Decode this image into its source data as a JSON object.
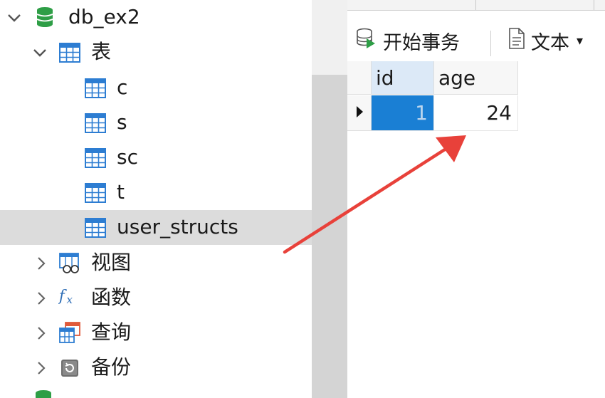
{
  "tree": {
    "database": {
      "label": "db_ex2"
    },
    "tables_group": {
      "label": "表"
    },
    "tables": [
      {
        "label": "c"
      },
      {
        "label": "s"
      },
      {
        "label": "sc"
      },
      {
        "label": "t"
      },
      {
        "label": "user_structs",
        "selected": true
      }
    ],
    "groups": [
      {
        "label": "视图",
        "icon": "view-icon"
      },
      {
        "label": "函数",
        "icon": "function-icon"
      },
      {
        "label": "查询",
        "icon": "query-icon"
      },
      {
        "label": "备份",
        "icon": "backup-icon"
      }
    ]
  },
  "toolbar": {
    "begin_transaction": "开始事务",
    "text": "文本"
  },
  "grid": {
    "columns": [
      "id",
      "age"
    ],
    "rows": [
      {
        "id": "1",
        "age": "24"
      }
    ]
  },
  "colors": {
    "accent": "#1a7fd4",
    "arrow": "#e8413a",
    "db_green": "#2e9e46",
    "table_blue": "#2d7dd2"
  }
}
